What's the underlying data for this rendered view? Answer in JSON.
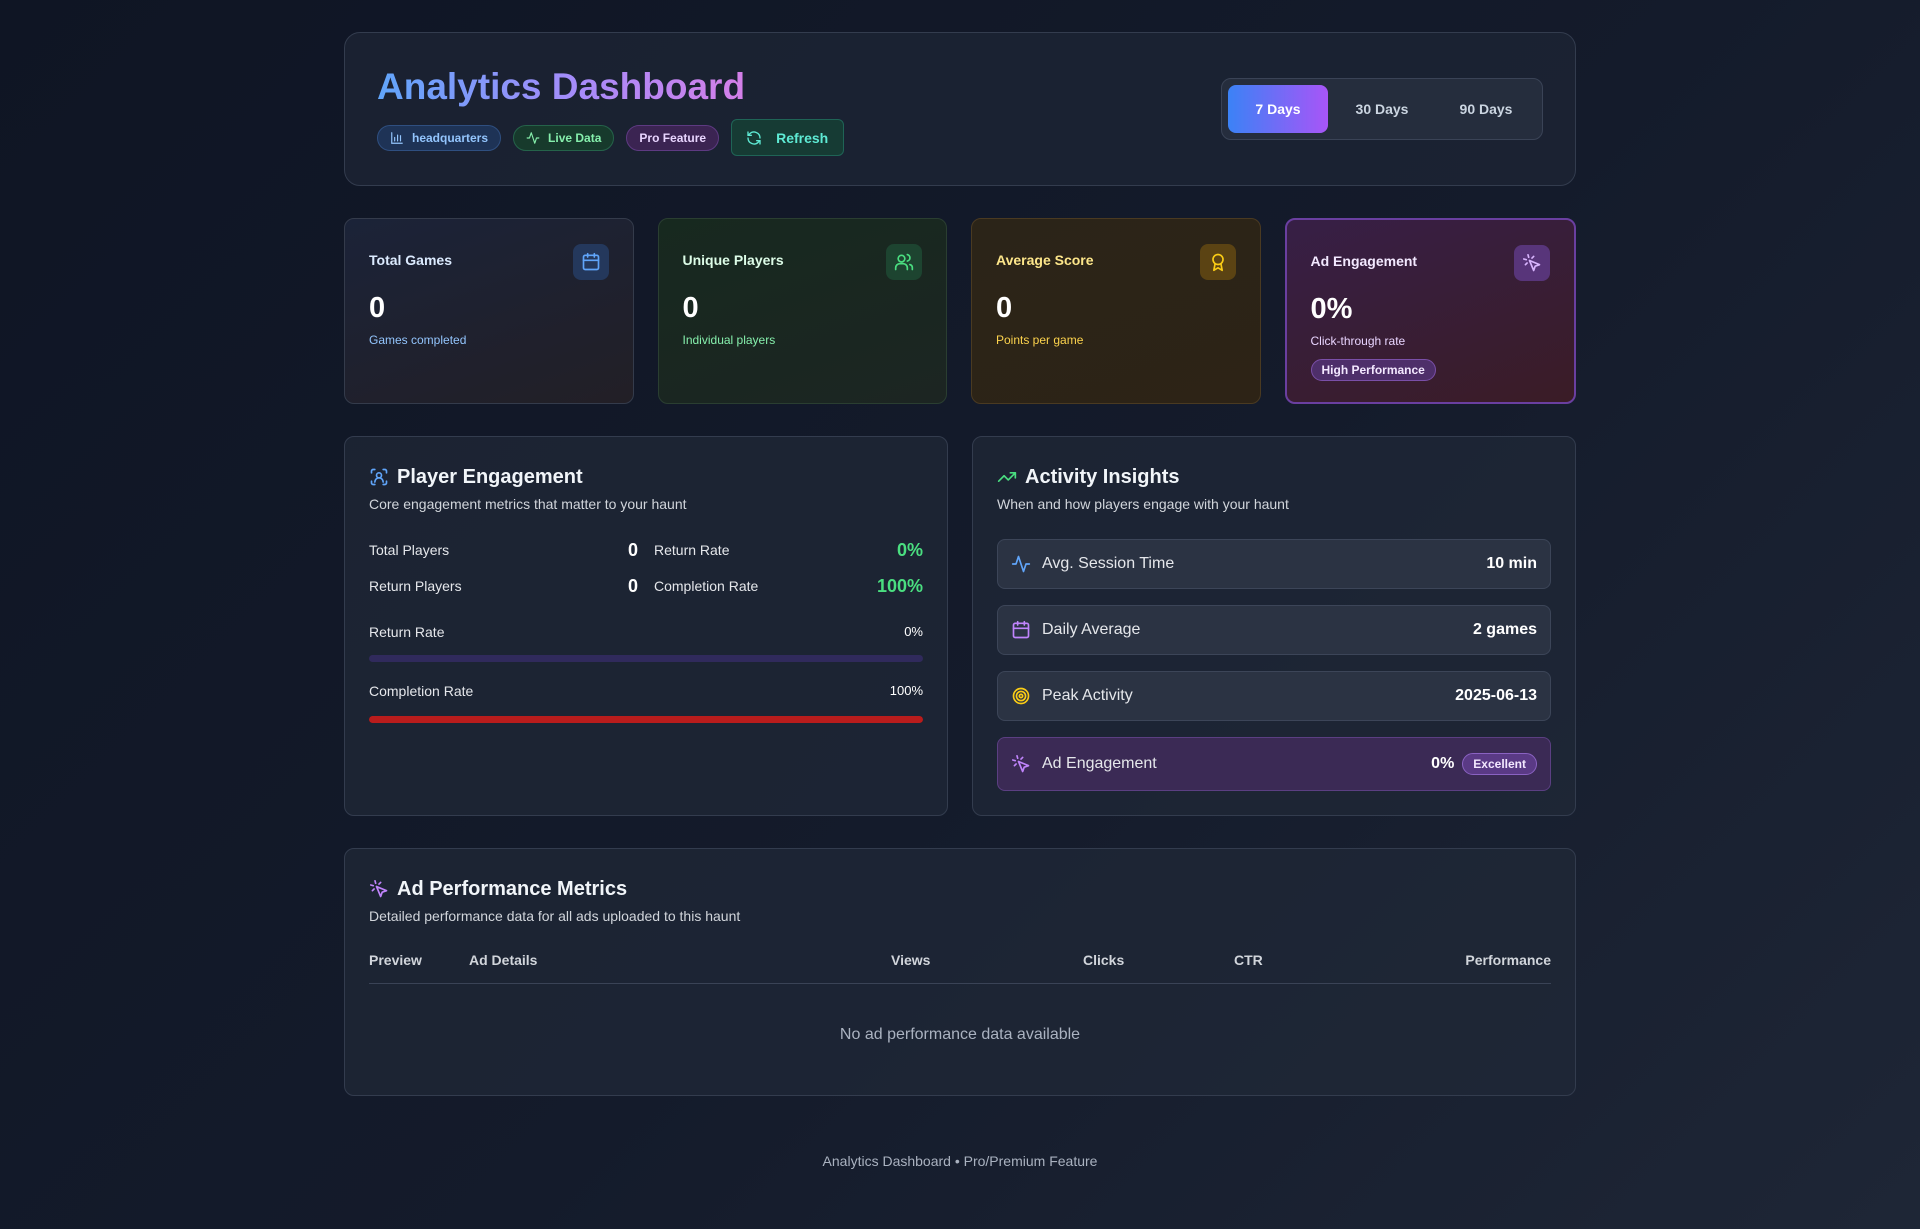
{
  "header": {
    "title": "Analytics Dashboard",
    "badges": {
      "hq": "headquarters",
      "live": "Live Data",
      "pro": "Pro Feature"
    },
    "refresh_label": "Refresh",
    "ranges": [
      "7 Days",
      "30 Days",
      "90 Days"
    ],
    "active_range": "7 Days"
  },
  "stats": {
    "games": {
      "label": "Total Games",
      "value": "0",
      "sub": "Games completed",
      "color": "#93c5fd"
    },
    "players": {
      "label": "Unique Players",
      "value": "0",
      "sub": "Individual players",
      "color": "#86efac"
    },
    "score": {
      "label": "Average Score",
      "value": "0",
      "sub": "Points per game",
      "color": "#fcd34d"
    },
    "ad": {
      "label": "Ad Engagement",
      "value": "0%",
      "sub": "Click-through rate",
      "badge": "High Performance",
      "color": "#e9d5ff"
    }
  },
  "engagement": {
    "title": "Player Engagement",
    "desc": "Core engagement metrics that matter to your haunt",
    "total_players_label": "Total Players",
    "total_players": "0",
    "return_rate_label": "Return Rate",
    "return_rate": "0%",
    "return_players_label": "Return Players",
    "return_players": "0",
    "completion_rate_label": "Completion Rate",
    "completion_rate": "100%",
    "bars": {
      "return": {
        "label": "Return Rate",
        "pct": "0%",
        "fraction": 0.0
      },
      "completion": {
        "label": "Completion Rate",
        "pct": "100%",
        "fraction": 1.0
      }
    }
  },
  "insights": {
    "title": "Activity Insights",
    "desc": "When and how players engage with your haunt",
    "session": {
      "label": "Avg. Session Time",
      "value": "10 min"
    },
    "daily": {
      "label": "Daily Average",
      "value": "2 games"
    },
    "peak": {
      "label": "Peak Activity",
      "value": "2025-06-13"
    },
    "ad": {
      "label": "Ad Engagement",
      "value": "0%",
      "badge": "Excellent"
    }
  },
  "ad_performance": {
    "title": "Ad Performance Metrics",
    "desc": "Detailed performance data for all ads uploaded to this haunt",
    "columns": [
      "Preview",
      "Ad Details",
      "Views",
      "Clicks",
      "CTR",
      "Performance"
    ],
    "empty_message": "No ad performance data available"
  },
  "footer": "Analytics Dashboard • Pro/Premium Feature",
  "colors": {
    "accent_blue": "#3b82f6",
    "accent_purple": "#a855f7",
    "success": "#4ade80",
    "danger": "#b91c1c"
  }
}
